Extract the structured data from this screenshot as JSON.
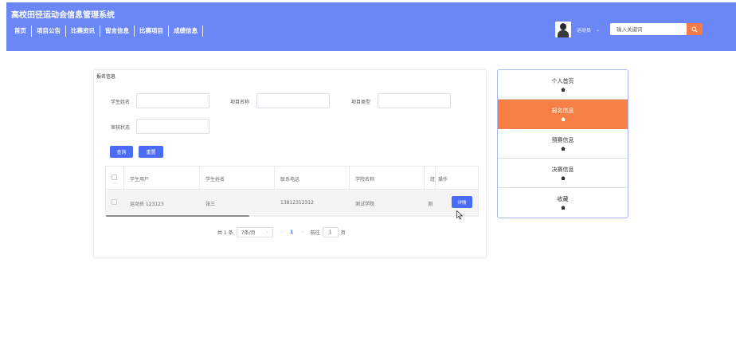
{
  "header": {
    "site_title": "高校田径运动会信息管理系统",
    "nav": [
      "首页",
      "项目公告",
      "比赛资讯",
      "留言信息",
      "比赛项目",
      "成绩信息"
    ],
    "username": "运动员",
    "dropdown_icon": "caret-down-icon",
    "search_placeholder": "输入关键词",
    "search_icon": "search-icon"
  },
  "main": {
    "title": "报名信息",
    "filters": {
      "student_name_label": "学生姓名",
      "project_name_label": "项目名称",
      "project_type_label": "项目类型",
      "review_status_label": "审核状态"
    },
    "query_button": "查询",
    "reset_button": "重置",
    "table": {
      "headers": [
        "学生用户",
        "学生姓名",
        "联系电话",
        "学院名称",
        "班",
        "操作"
      ],
      "rows": [
        {
          "user": "运动员 123123",
          "name": "张三",
          "phone": "13812312312",
          "college": "测试学院",
          "class_partial": "测",
          "action": "详情"
        }
      ]
    },
    "pagination": {
      "total": "共 1 条",
      "page_size": "7条/页",
      "prev": "‹",
      "current_page": "1",
      "next": "›",
      "goto_label": "前往",
      "goto_value": "1",
      "page_unit": "页"
    }
  },
  "side_menu": {
    "items": [
      {
        "label": "个人首页",
        "active": false
      },
      {
        "label": "报名信息",
        "active": true
      },
      {
        "label": "预赛信息",
        "active": false
      },
      {
        "label": "决赛信息",
        "active": false
      },
      {
        "label": "收藏",
        "active": false
      }
    ]
  },
  "colors": {
    "header_bg": "#6b86f5",
    "primary_button": "#4a6cf5",
    "active_menu": "#f57f45",
    "search_button": "#f47a4a"
  }
}
